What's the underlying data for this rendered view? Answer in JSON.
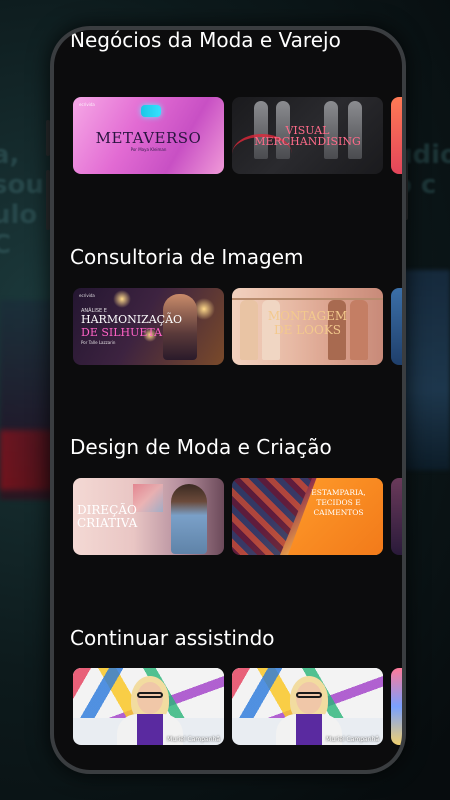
{
  "background": {
    "left_text": "a, sou ulo C",
    "right_text": "udio o c"
  },
  "sections": [
    {
      "title": "Negócios da Moda e Varejo",
      "cards": [
        {
          "title": "METAVERSO",
          "subtitle": "Por Maya Kleiman",
          "brand": "ecrivida"
        },
        {
          "title": "VISUAL MERCHANDISING",
          "subtitle": ""
        }
      ]
    },
    {
      "title": "Consultoria de Imagem",
      "cards": [
        {
          "title": "ANÁLISE E HARMONIZAÇÃO DE SILHUETA",
          "line1": "ANÁLISE E",
          "line2": "HARMONIZAÇÃO",
          "line3": "DE SILHUETA",
          "subtitle": "Por Talle Lazzarin",
          "brand": "ecrivida"
        },
        {
          "title": "MONTAGEM DE LOOKS",
          "line1": "MONTAGEM",
          "line2": "DE LOOKS"
        }
      ]
    },
    {
      "title": "Design de Moda e Criação",
      "cards": [
        {
          "title": "DIREÇÃO CRIATIVA",
          "line1": "DIREÇÃO",
          "line2": "CRIATIVA"
        },
        {
          "title": "ESTAMPARIA, TECIDOS E CAIMENTOS",
          "line1": "ESTAMPARIA,",
          "line2": "TECIDOS E",
          "line3": "CAIMENTOS"
        }
      ]
    },
    {
      "title": "Continuar assistindo",
      "cards": [
        {
          "name_tag": "Muriel Campanhã"
        },
        {
          "name_tag": "Muriel Campanhã"
        }
      ]
    }
  ]
}
